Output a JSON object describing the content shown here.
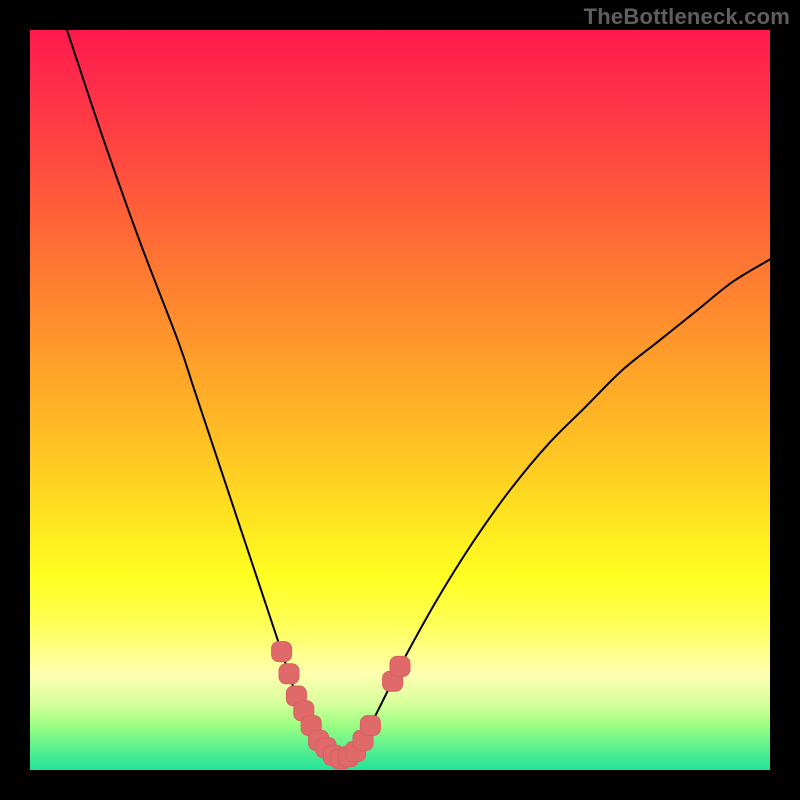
{
  "watermark": "TheBottleneck.com",
  "colors": {
    "background": "#000000",
    "curve_stroke": "#000000",
    "marker_fill": "#e06a6a",
    "marker_stroke": "#d85e5e"
  },
  "chart_data": {
    "type": "line",
    "title": "",
    "xlabel": "",
    "ylabel": "",
    "xlim": [
      0,
      100
    ],
    "ylim": [
      0,
      100
    ],
    "x": [
      5,
      10,
      15,
      20,
      22,
      24,
      26,
      28,
      30,
      31,
      32,
      33,
      34,
      35,
      36,
      37,
      38,
      39,
      40,
      41,
      42,
      43,
      44,
      45,
      46,
      48,
      50,
      55,
      60,
      65,
      70,
      75,
      80,
      85,
      90,
      95,
      100
    ],
    "y": [
      100,
      85,
      71,
      58,
      52,
      46,
      40,
      34,
      28,
      25,
      22,
      19,
      16,
      13,
      10,
      8,
      6,
      4,
      3,
      2,
      1.5,
      1.8,
      2.5,
      4,
      6,
      10,
      14,
      23,
      31,
      38,
      44,
      49,
      54,
      58,
      62,
      66,
      69
    ],
    "highlight_points": [
      {
        "x": 34,
        "y": 16
      },
      {
        "x": 35,
        "y": 13
      },
      {
        "x": 36,
        "y": 10
      },
      {
        "x": 37,
        "y": 8
      },
      {
        "x": 38,
        "y": 6
      },
      {
        "x": 39,
        "y": 4
      },
      {
        "x": 40,
        "y": 3
      },
      {
        "x": 41,
        "y": 2
      },
      {
        "x": 42,
        "y": 1.5
      },
      {
        "x": 43,
        "y": 1.8
      },
      {
        "x": 44,
        "y": 2.5
      },
      {
        "x": 45,
        "y": 4
      },
      {
        "x": 46,
        "y": 6
      },
      {
        "x": 49,
        "y": 12
      },
      {
        "x": 50,
        "y": 14
      }
    ],
    "annotations": []
  }
}
